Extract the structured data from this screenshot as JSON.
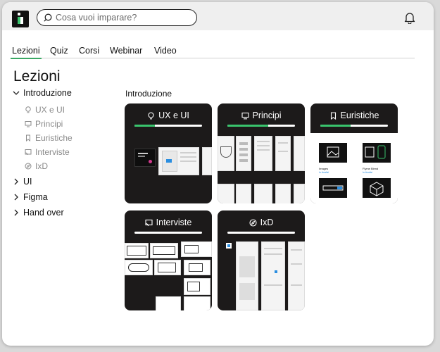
{
  "header": {
    "search_placeholder": "Cosa vuoi imparare?"
  },
  "tabs": [
    {
      "label": "Lezioni"
    },
    {
      "label": "Quiz"
    },
    {
      "label": "Corsi"
    },
    {
      "label": "Webinar"
    },
    {
      "label": "Video"
    }
  ],
  "page_title": "Lezioni",
  "tree": {
    "sections": [
      {
        "label": "Introduzione",
        "expanded": true
      },
      {
        "label": "UI",
        "expanded": false
      },
      {
        "label": "Figma",
        "expanded": false
      },
      {
        "label": "Hand over",
        "expanded": false
      }
    ],
    "sub_items": [
      {
        "label": "UX e UI",
        "icon": "bulb-icon"
      },
      {
        "label": "Principi",
        "icon": "monitor-icon"
      },
      {
        "label": "Euristiche",
        "icon": "bookmark-icon"
      },
      {
        "label": "Interviste",
        "icon": "cast-icon"
      },
      {
        "label": "IxD",
        "icon": "compass-icon"
      }
    ]
  },
  "section_label": "Introduzione",
  "cards": [
    {
      "title": "UX e UI",
      "icon": "bulb-icon",
      "progress": 0.3
    },
    {
      "title": "Principi",
      "icon": "monitor-icon",
      "progress": 0.6
    },
    {
      "title": "Euristiche",
      "icon": "bookmark-icon",
      "progress": 0.45
    },
    {
      "title": "Interviste",
      "icon": "cast-icon",
      "progress": 0.0
    },
    {
      "title": "IxD",
      "icon": "compass-icon",
      "progress": 0.0
    }
  ],
  "card_thumbs": {
    "euristiche": [
      {
        "title": "Images",
        "caption": "In Analisi"
      },
      {
        "title": "Flyme Blend",
        "caption": "In Analisi"
      }
    ]
  },
  "colors": {
    "accent": "#39c46d",
    "card_bg": "#1c1a1a",
    "topbar_bg": "#efefef"
  }
}
